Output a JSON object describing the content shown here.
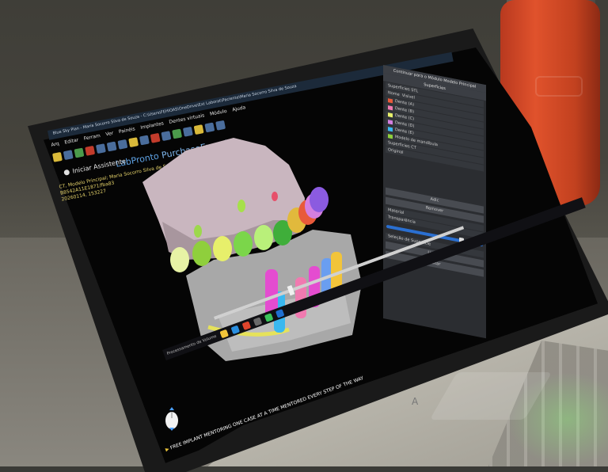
{
  "window": {
    "title": "Blue Sky Plan - Maria Socorro Silva de Souza - C:\\Users\\FEHIOAS\\OneDrive\\Ext Laborat\\Paciente\\Maria Socorro Silva de Souza"
  },
  "menu": [
    "Arq",
    "Editar",
    "Ferram",
    "Ver",
    "Painéis",
    "Implantes",
    "Dentes virtuais",
    "Módulo",
    "Ajuda"
  ],
  "assistant": {
    "label": "Iniciar Assistente"
  },
  "brand": {
    "name": "LabPronto",
    "partner": "PurchaseExports"
  },
  "patient": {
    "line1": "CT, Modelo Principal; Maria Socorro Silva de Souza",
    "line2": "B8542A11E1871/fba83",
    "line3": "20260114, 153227"
  },
  "panel": {
    "continue_label": "Continuar para o Módulo Modelo Principal",
    "surfaces_header": "Superfícies",
    "stl_section": "Superfícies STL",
    "name_col": "Nome",
    "visible_col": "Visível",
    "stl_rows": [
      "Dente (A)",
      "Dente (B)",
      "Dente (C)",
      "Dente (D)",
      "Dente (E)",
      "Modelo de mandíbula"
    ],
    "ct_section": "Superfícies CT",
    "ct_rows": [
      "Original"
    ],
    "material_label": "Material",
    "transparency_label": "Transparência",
    "selection_label": "Seleção de Superfície",
    "buttons": [
      "Adic",
      "Remover",
      "Limpar",
      "Editar"
    ]
  },
  "taskbar": {
    "label": "Processamento de Volume",
    "apps": [
      "explorer",
      "edge",
      "chrome",
      "store",
      "whatsapp",
      "mail"
    ]
  },
  "ticker": {
    "text": "FREE IMPLANT MENTORING ONE CASE AT A TIME MENTORED EVERY STEP OF THE WAY"
  },
  "colors": {
    "accent": "#2a6fd1",
    "brand": "#5fa3e6",
    "patient_text": "#e6d36a",
    "bottle": "#e0522c",
    "background": "#050505"
  },
  "teeth_colors": [
    "#e7f2a5",
    "#8fcf3c",
    "#e7ef6b",
    "#7bd64a",
    "#b9f07a",
    "#3fae3a",
    "#e1b93c",
    "#e85a3a",
    "#d47fe0",
    "#8b5be0",
    "#3ab8f0",
    "#f07ab0",
    "#e44cd0",
    "#6a9ef0",
    "#f2c43a"
  ]
}
